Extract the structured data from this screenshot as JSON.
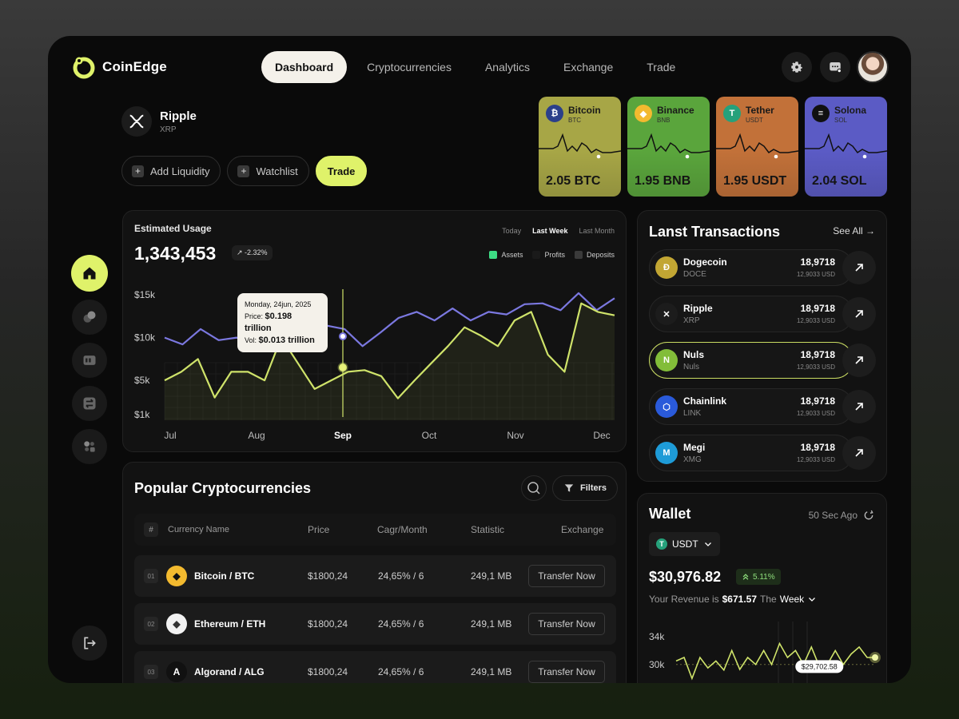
{
  "brand": {
    "name": "CoinEdge"
  },
  "nav": {
    "items": [
      {
        "label": "Dashboard",
        "active": true
      },
      {
        "label": "Cryptocurrencies"
      },
      {
        "label": "Analytics"
      },
      {
        "label": "Exchange"
      },
      {
        "label": "Trade"
      }
    ]
  },
  "header_icons": [
    "gear-icon",
    "chat-icon",
    "avatar"
  ],
  "coin": {
    "name": "Ripple",
    "symbol": "XRP"
  },
  "actions": {
    "add_liquidity": "Add Liquidity",
    "watchlist": "Watchlist",
    "trade": "Trade"
  },
  "coin_cards": [
    {
      "name": "Bitcoin",
      "symbol": "BTC",
      "value": "2.05 BTC",
      "color": "#a7a646",
      "icon_glyph": "₿",
      "icon_color": "#2b3f8a"
    },
    {
      "name": "Binance",
      "symbol": "BNB",
      "value": "1.95 BNB",
      "color": "#5aa53c",
      "icon_glyph": "◆",
      "icon_color": "#f3ba2f"
    },
    {
      "name": "Tether",
      "symbol": "USDT",
      "value": "1.95 USDT",
      "color": "#c27139",
      "icon_glyph": "T",
      "icon_color": "#26a17b"
    },
    {
      "name": "Solona",
      "symbol": "SOL",
      "value": "2.04 SOL",
      "color": "#5b5bc5",
      "icon_glyph": "≡",
      "icon_color": "#111111"
    }
  ],
  "usage": {
    "title": "Estimated Usage",
    "value": "1,343,453",
    "change": "-2.32%",
    "timeframes": [
      {
        "label": "Today"
      },
      {
        "label": "Last Week",
        "active": true
      },
      {
        "label": "Last Month"
      }
    ],
    "legend": [
      {
        "label": "Assets",
        "color": "#3ddc84"
      },
      {
        "label": "Profits",
        "color": "#1a1a1a"
      },
      {
        "label": "Deposits",
        "color": "#3a3a3a"
      }
    ],
    "tooltip": {
      "date": "Monday, 24jun, 2025",
      "price_label": "Price:",
      "price": "$0.198 trillion",
      "vol_label": "Vol:",
      "vol": "$0.013 trillion"
    }
  },
  "chart_data": {
    "type": "line",
    "x": [
      "Jul",
      "Aug",
      "Sep",
      "Oct",
      "Nov",
      "Dec"
    ],
    "highlight_x": "Sep",
    "yticks": [
      "$15k",
      "$10k",
      "$5k",
      "$1k"
    ],
    "ylim": [
      1,
      15
    ],
    "series": [
      {
        "color": "#7b78e0",
        "values": [
          10.0,
          9.2,
          11.0,
          9.7,
          10.0,
          9.2,
          10.0,
          10.6,
          11.3,
          11.4,
          11.0,
          9.0,
          10.6,
          12.3,
          13.0,
          12.0,
          13.4,
          12.0,
          13.0,
          12.7,
          13.9,
          14.0,
          13.2,
          15.2,
          13.2,
          14.6
        ]
      },
      {
        "color": "#cfe36a",
        "values": [
          5.0,
          6.0,
          7.5,
          3.0,
          6.0,
          6.0,
          5.0,
          10.0,
          7.0,
          4.0,
          5.0,
          6.0,
          6.2,
          5.5,
          2.9,
          5.0,
          7.0,
          9.0,
          11.2,
          10.2,
          9.0,
          12.0,
          13.0,
          8.0,
          6.0,
          14.0,
          13.0,
          12.6
        ]
      }
    ]
  },
  "popular": {
    "title": "Popular Cryptocurrencies",
    "filters_label": "Filters",
    "columns": [
      "#",
      "Currency Name",
      "Price",
      "Cagr/Month",
      "Statistic",
      "Exchange"
    ],
    "rows": [
      {
        "idx": "01",
        "name": "Bitcoin / BTC",
        "price": "$1800,24",
        "cagr": "24,65% / 6",
        "stat": "249,1 MB",
        "action": "Transfer Now",
        "icon_bg": "#f3ba2f",
        "icon_glyph": "◆",
        "icon_color": "#111111"
      },
      {
        "idx": "02",
        "name": "Ethereum / ETH",
        "price": "$1800,24",
        "cagr": "24,65% / 6",
        "stat": "249,1 MB",
        "action": "Transfer Now",
        "icon_bg": "#f2f2f2",
        "icon_glyph": "◆",
        "icon_color": "#333333"
      },
      {
        "idx": "03",
        "name": "Algorand / ALG",
        "price": "$1800,24",
        "cagr": "24,65% / 6",
        "stat": "249,1 MB",
        "action": "Transfer Now",
        "icon_bg": "#111111",
        "icon_glyph": "A",
        "icon_color": "#ffffff"
      }
    ]
  },
  "transactions": {
    "title": "Lanst Transactions",
    "see_all": "See All",
    "items": [
      {
        "name": "Dogecoin",
        "symbol": "DOCE",
        "amount": "18,9718",
        "usd": "12,9033 USD",
        "icon_bg": "#c2a633",
        "icon_glyph": "Ð",
        "icon_color": "#ffffff"
      },
      {
        "name": "Ripple",
        "symbol": "XRP",
        "amount": "18,9718",
        "usd": "12,9033 USD",
        "icon_bg": "#1c1c1c",
        "icon_glyph": "✕",
        "icon_color": "#ffffff"
      },
      {
        "name": "Nuls",
        "symbol": "Nuls",
        "amount": "18,9718",
        "usd": "12,9033 USD",
        "highlight": true,
        "icon_bg": "#82bd39",
        "icon_glyph": "N",
        "icon_color": "#ffffff"
      },
      {
        "name": "Chainlink",
        "symbol": "LINK",
        "amount": "18,9718",
        "usd": "12,9033 USD",
        "icon_bg": "#2a5ada",
        "icon_glyph": "⬡",
        "icon_color": "#ffffff"
      },
      {
        "name": "Megi",
        "symbol": "XMG",
        "amount": "18,9718",
        "usd": "12,9033 USD",
        "icon_bg": "#1e9bd7",
        "icon_glyph": "M",
        "icon_color": "#ffffff"
      }
    ]
  },
  "wallet": {
    "title": "Wallet",
    "updated": "50 Sec Ago",
    "currency": "USDT",
    "amount": "$30,976.82",
    "change": "5.11%",
    "revenue_prefix": "Your Revenue is",
    "revenue_value": "$671.57",
    "revenue_mid": "The",
    "revenue_period": "Week",
    "yticks": [
      "34k",
      "30k"
    ],
    "marker_value": "$29,702.58",
    "values": [
      30.5,
      31.0,
      28.0,
      31.0,
      29.5,
      30.5,
      29.2,
      32.0,
      29.3,
      31.0,
      30.0,
      32.0,
      30.0,
      33.0,
      31.0,
      32.0,
      30.0,
      32.5,
      29.7,
      30.0,
      32.0,
      30.0,
      31.5,
      32.5,
      31.0,
      31.0
    ]
  }
}
